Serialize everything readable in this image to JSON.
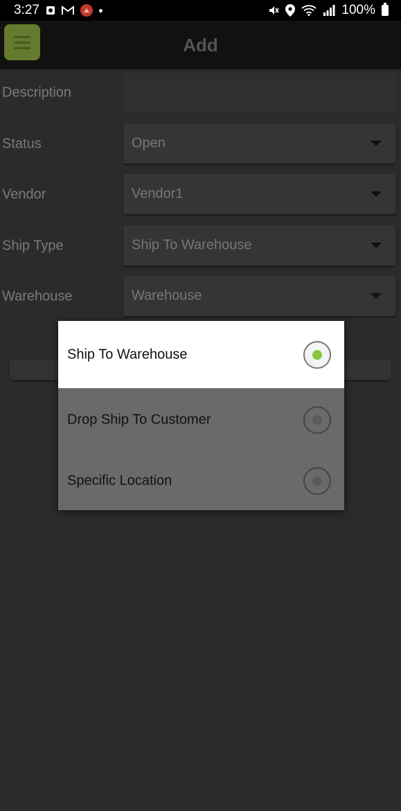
{
  "status_bar": {
    "time": "3:27",
    "battery": "100%",
    "icons": [
      "notification-icon",
      "gmail-icon",
      "app-icon",
      "mute-icon",
      "location-icon",
      "wifi-icon",
      "signal-icon",
      "battery-icon"
    ]
  },
  "header": {
    "title": "Add",
    "menu_icon": "hamburger-icon"
  },
  "form": {
    "description": {
      "label": "Description",
      "value": ""
    },
    "status": {
      "label": "Status",
      "value": "Open"
    },
    "vendor": {
      "label": "Vendor",
      "value": "Vendor1"
    },
    "ship_type": {
      "label": "Ship Type",
      "value": "Ship To Warehouse"
    },
    "warehouse": {
      "label": "Warehouse",
      "value": "Warehouse"
    }
  },
  "picker": {
    "options": [
      {
        "label": "Ship To Warehouse",
        "selected": true
      },
      {
        "label": "Drop Ship To Customer",
        "selected": false
      },
      {
        "label": "Specific Location",
        "selected": false
      }
    ]
  },
  "colors": {
    "accent_green": "#8cc63f",
    "menu_button": "#647a2e",
    "background": "#2b2b2b"
  }
}
